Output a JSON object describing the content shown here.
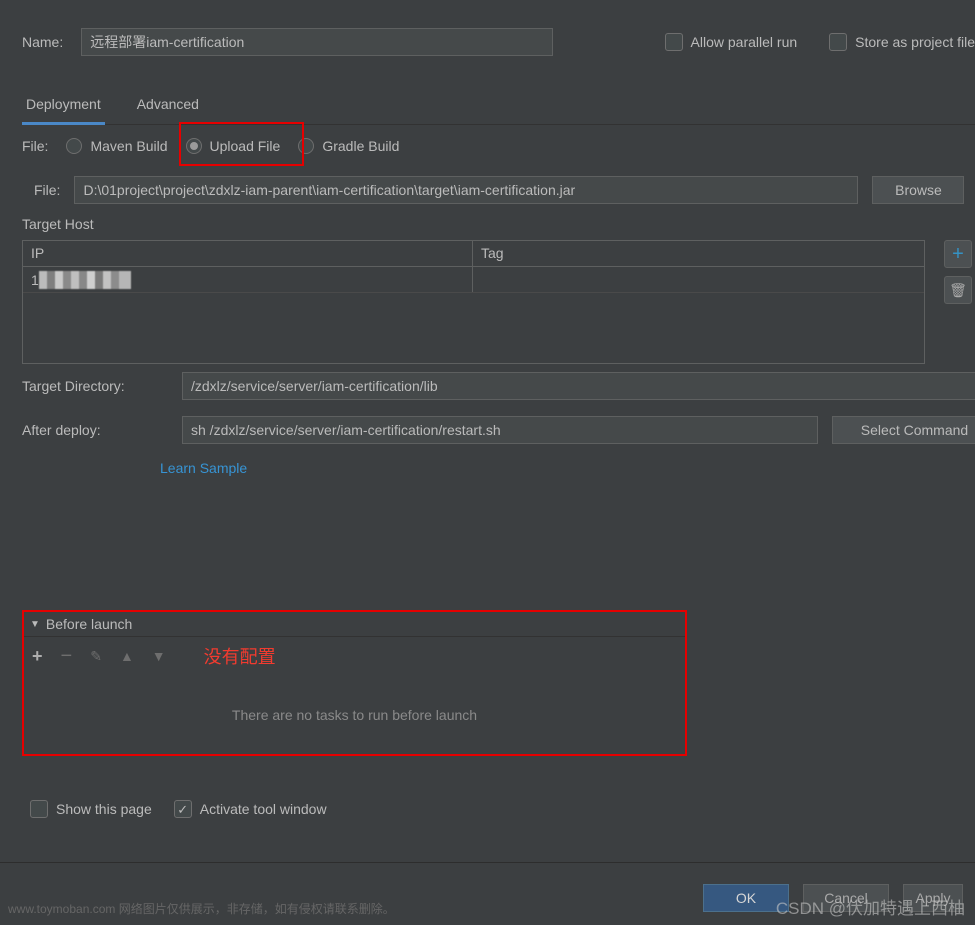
{
  "top": {
    "name_label": "Name:",
    "name_value": "远程部署iam-certification",
    "allow_parallel": "Allow parallel run",
    "store_as_project": "Store as project file"
  },
  "tabs": {
    "deployment": "Deployment",
    "advanced": "Advanced"
  },
  "file": {
    "label": "File:",
    "radio_maven": "Maven Build",
    "radio_upload": "Upload File",
    "radio_gradle": "Gradle Build",
    "path_label": "File:",
    "path_value": "D:\\01project\\project\\zdxlz-iam-parent\\iam-certification\\target\\iam-certification.jar",
    "browse": "Browse"
  },
  "target_host": {
    "label": "Target Host",
    "col_ip": "IP",
    "col_tag": "Tag",
    "rows": [
      {
        "ip_masked": true,
        "tag": ""
      }
    ]
  },
  "target_dir": {
    "label": "Target Directory:",
    "value": "/zdxlz/service/server/iam-certification/lib"
  },
  "after_deploy": {
    "label": "After deploy:",
    "value": "sh /zdxlz/service/server/iam-certification/restart.sh",
    "select_cmd": "Select Command",
    "learn_sample": "Learn Sample"
  },
  "before_launch": {
    "title": "Before launch",
    "annotation": "没有配置",
    "empty_text": "There are no tasks to run before launch"
  },
  "bottom_checks": {
    "show_page": "Show this page",
    "activate_tool": "Activate tool window"
  },
  "buttons": {
    "ok": "OK",
    "cancel": "Cancel",
    "apply": "Apply"
  },
  "watermark": {
    "left": "www.toymoban.com 网络图片仅供展示，非存储，如有侵权请联系删除。",
    "right": "CSDN @伏加特遇上西柚"
  }
}
